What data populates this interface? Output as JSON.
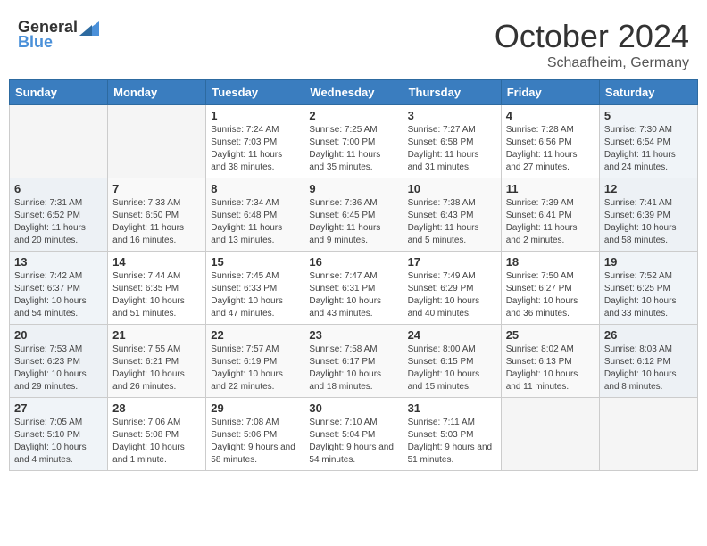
{
  "header": {
    "logo_general": "General",
    "logo_blue": "Blue",
    "month_title": "October 2024",
    "subtitle": "Schaafheim, Germany"
  },
  "weekdays": [
    "Sunday",
    "Monday",
    "Tuesday",
    "Wednesday",
    "Thursday",
    "Friday",
    "Saturday"
  ],
  "weeks": [
    [
      {
        "day": "",
        "info": ""
      },
      {
        "day": "",
        "info": ""
      },
      {
        "day": "1",
        "info": "Sunrise: 7:24 AM\nSunset: 7:03 PM\nDaylight: 11 hours and 38 minutes."
      },
      {
        "day": "2",
        "info": "Sunrise: 7:25 AM\nSunset: 7:00 PM\nDaylight: 11 hours and 35 minutes."
      },
      {
        "day": "3",
        "info": "Sunrise: 7:27 AM\nSunset: 6:58 PM\nDaylight: 11 hours and 31 minutes."
      },
      {
        "day": "4",
        "info": "Sunrise: 7:28 AM\nSunset: 6:56 PM\nDaylight: 11 hours and 27 minutes."
      },
      {
        "day": "5",
        "info": "Sunrise: 7:30 AM\nSunset: 6:54 PM\nDaylight: 11 hours and 24 minutes."
      }
    ],
    [
      {
        "day": "6",
        "info": "Sunrise: 7:31 AM\nSunset: 6:52 PM\nDaylight: 11 hours and 20 minutes."
      },
      {
        "day": "7",
        "info": "Sunrise: 7:33 AM\nSunset: 6:50 PM\nDaylight: 11 hours and 16 minutes."
      },
      {
        "day": "8",
        "info": "Sunrise: 7:34 AM\nSunset: 6:48 PM\nDaylight: 11 hours and 13 minutes."
      },
      {
        "day": "9",
        "info": "Sunrise: 7:36 AM\nSunset: 6:45 PM\nDaylight: 11 hours and 9 minutes."
      },
      {
        "day": "10",
        "info": "Sunrise: 7:38 AM\nSunset: 6:43 PM\nDaylight: 11 hours and 5 minutes."
      },
      {
        "day": "11",
        "info": "Sunrise: 7:39 AM\nSunset: 6:41 PM\nDaylight: 11 hours and 2 minutes."
      },
      {
        "day": "12",
        "info": "Sunrise: 7:41 AM\nSunset: 6:39 PM\nDaylight: 10 hours and 58 minutes."
      }
    ],
    [
      {
        "day": "13",
        "info": "Sunrise: 7:42 AM\nSunset: 6:37 PM\nDaylight: 10 hours and 54 minutes."
      },
      {
        "day": "14",
        "info": "Sunrise: 7:44 AM\nSunset: 6:35 PM\nDaylight: 10 hours and 51 minutes."
      },
      {
        "day": "15",
        "info": "Sunrise: 7:45 AM\nSunset: 6:33 PM\nDaylight: 10 hours and 47 minutes."
      },
      {
        "day": "16",
        "info": "Sunrise: 7:47 AM\nSunset: 6:31 PM\nDaylight: 10 hours and 43 minutes."
      },
      {
        "day": "17",
        "info": "Sunrise: 7:49 AM\nSunset: 6:29 PM\nDaylight: 10 hours and 40 minutes."
      },
      {
        "day": "18",
        "info": "Sunrise: 7:50 AM\nSunset: 6:27 PM\nDaylight: 10 hours and 36 minutes."
      },
      {
        "day": "19",
        "info": "Sunrise: 7:52 AM\nSunset: 6:25 PM\nDaylight: 10 hours and 33 minutes."
      }
    ],
    [
      {
        "day": "20",
        "info": "Sunrise: 7:53 AM\nSunset: 6:23 PM\nDaylight: 10 hours and 29 minutes."
      },
      {
        "day": "21",
        "info": "Sunrise: 7:55 AM\nSunset: 6:21 PM\nDaylight: 10 hours and 26 minutes."
      },
      {
        "day": "22",
        "info": "Sunrise: 7:57 AM\nSunset: 6:19 PM\nDaylight: 10 hours and 22 minutes."
      },
      {
        "day": "23",
        "info": "Sunrise: 7:58 AM\nSunset: 6:17 PM\nDaylight: 10 hours and 18 minutes."
      },
      {
        "day": "24",
        "info": "Sunrise: 8:00 AM\nSunset: 6:15 PM\nDaylight: 10 hours and 15 minutes."
      },
      {
        "day": "25",
        "info": "Sunrise: 8:02 AM\nSunset: 6:13 PM\nDaylight: 10 hours and 11 minutes."
      },
      {
        "day": "26",
        "info": "Sunrise: 8:03 AM\nSunset: 6:12 PM\nDaylight: 10 hours and 8 minutes."
      }
    ],
    [
      {
        "day": "27",
        "info": "Sunrise: 7:05 AM\nSunset: 5:10 PM\nDaylight: 10 hours and 4 minutes."
      },
      {
        "day": "28",
        "info": "Sunrise: 7:06 AM\nSunset: 5:08 PM\nDaylight: 10 hours and 1 minute."
      },
      {
        "day": "29",
        "info": "Sunrise: 7:08 AM\nSunset: 5:06 PM\nDaylight: 9 hours and 58 minutes."
      },
      {
        "day": "30",
        "info": "Sunrise: 7:10 AM\nSunset: 5:04 PM\nDaylight: 9 hours and 54 minutes."
      },
      {
        "day": "31",
        "info": "Sunrise: 7:11 AM\nSunset: 5:03 PM\nDaylight: 9 hours and 51 minutes."
      },
      {
        "day": "",
        "info": ""
      },
      {
        "day": "",
        "info": ""
      }
    ]
  ]
}
